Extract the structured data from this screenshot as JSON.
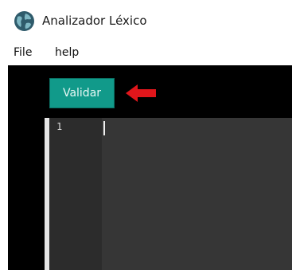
{
  "window": {
    "title": "Analizador Léxico",
    "icon": "globe-icon"
  },
  "menu": {
    "items": [
      {
        "label": "File"
      },
      {
        "label": "help"
      }
    ]
  },
  "toolbar": {
    "validate_label": "Validar",
    "annotation_icon": "red-arrow-icon"
  },
  "editor": {
    "line_numbers": [
      "1"
    ],
    "content": ""
  },
  "colors": {
    "button_bg": "#119a8a",
    "content_bg": "#000000",
    "editor_bg": "#363636",
    "gutter_bg": "#2c2c2c",
    "arrow": "#e0161b"
  }
}
